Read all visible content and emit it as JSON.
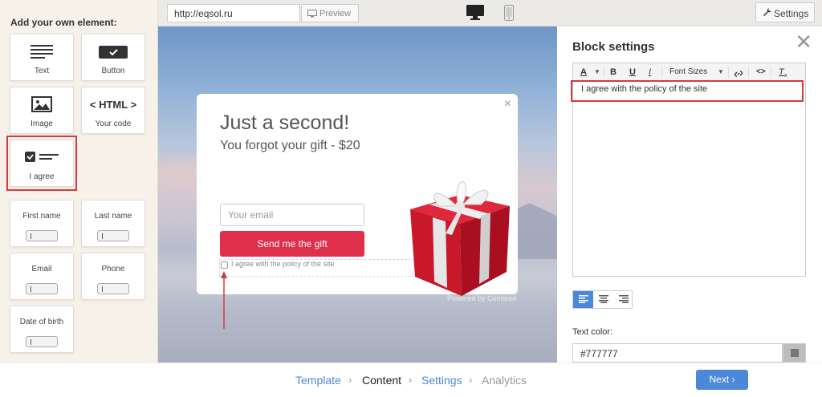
{
  "sidebar": {
    "title": "Add your own element:",
    "tiles": {
      "text": "Text",
      "button": "Button",
      "image": "Image",
      "code_icon": "< HTML >",
      "code": "Your code",
      "agree": "I agree",
      "first_name": "First name",
      "last_name": "Last name",
      "email": "Email",
      "phone": "Phone",
      "dob": "Date of birth"
    }
  },
  "topbar": {
    "url": "http://eqsol.ru",
    "preview": "Preview",
    "settings": "Settings"
  },
  "popup": {
    "close": "×",
    "title": "Just a second!",
    "subtitle": "You forgot your gift - $20",
    "email_placeholder": "Your email",
    "button": "Send me the gift",
    "agree": "I agree with the policy of the site",
    "powered": "Powered by Convead"
  },
  "block_settings": {
    "title": "Block settings",
    "close": "✕",
    "toolbar": {
      "font_sizes": "Font Sizes"
    },
    "editor_text": "I agree with the policy of the site",
    "text_color_label": "Text color:",
    "text_color_value": "#777777"
  },
  "nav": {
    "steps": [
      "Template",
      "Content",
      "Settings",
      "Analytics"
    ],
    "active": "Content",
    "next": "Next"
  },
  "colors": {
    "accent": "#4b88d8",
    "cta": "#df2f4a",
    "highlight": "#d9383e"
  }
}
